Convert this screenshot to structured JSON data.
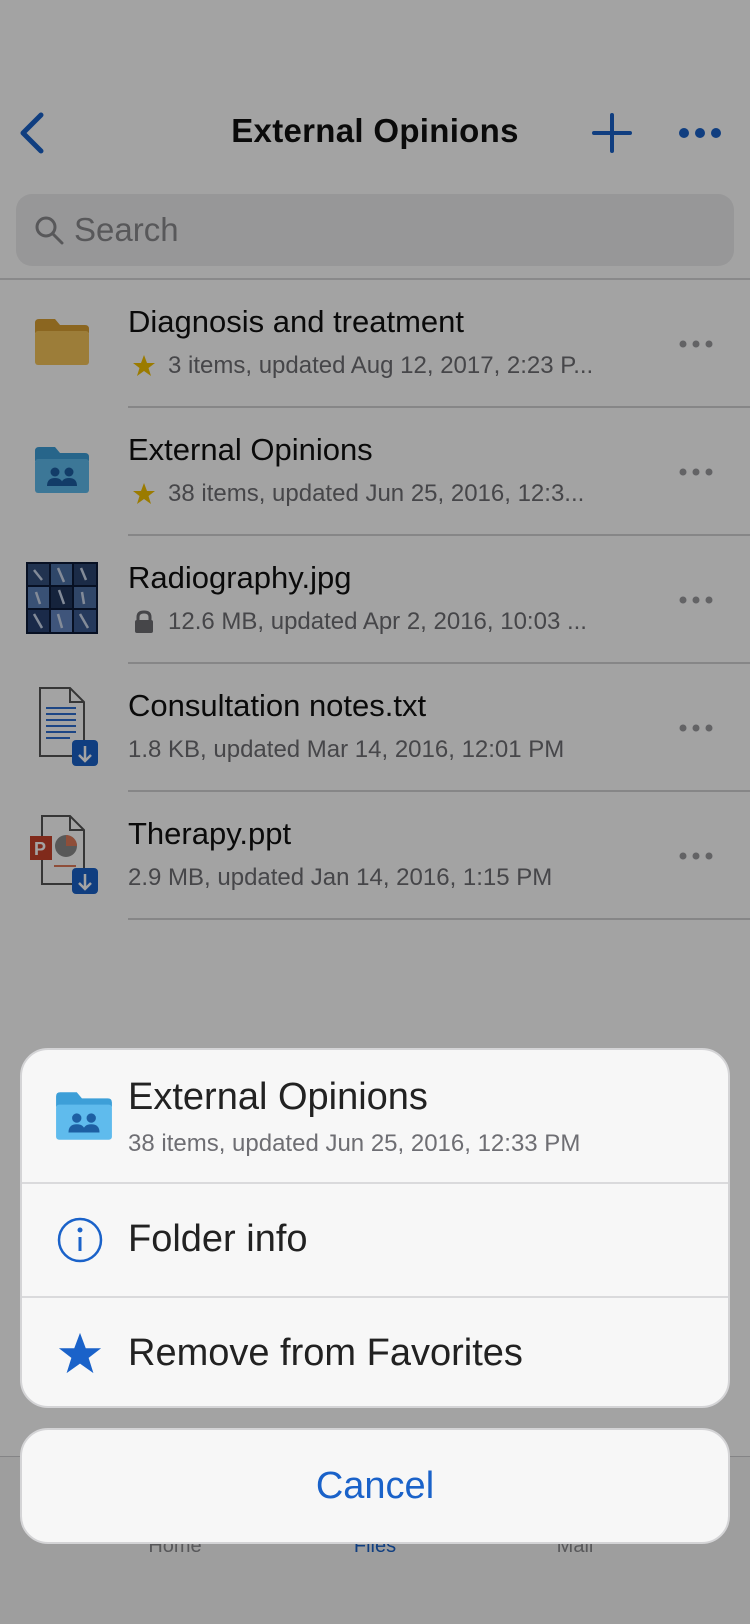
{
  "nav": {
    "title": "External Opinions",
    "back_icon": "chevron-left-icon",
    "add_icon": "plus-icon",
    "more_icon": "ellipsis-icon"
  },
  "search": {
    "placeholder": "Search"
  },
  "files": [
    {
      "name": "Diagnosis and treatment",
      "meta": "3 items, updated Aug 12, 2017, 2:23 P...",
      "badge": "star",
      "type": "folder"
    },
    {
      "name": "External Opinions",
      "meta": "38 items, updated Jun 25, 2016, 12:3...",
      "badge": "star",
      "type": "shared-folder"
    },
    {
      "name": "Radiography.jpg",
      "meta": "12.6 MB, updated Apr 2, 2016, 10:03 ...",
      "badge": "lock",
      "type": "image"
    },
    {
      "name": "Consultation notes.txt",
      "meta": "1.8 KB, updated Mar 14, 2016, 12:01 PM",
      "badge": "",
      "type": "text"
    },
    {
      "name": "Therapy.ppt",
      "meta": "2.9 MB, updated Jan 14, 2016, 1:15 PM",
      "badge": "",
      "type": "ppt"
    }
  ],
  "tabbar": {
    "home": "Home",
    "files": "Files",
    "mail": "Mail"
  },
  "sheet": {
    "title": "External Opinions",
    "subtitle": "38 items, updated Jun 25, 2016, 12:33 PM",
    "folder_info": "Folder info",
    "remove_favorites": "Remove from Favorites",
    "cancel": "Cancel"
  },
  "colors": {
    "accent": "#1a62c9",
    "star": "#f2c100",
    "folder_yellow": "#f5c45a",
    "folder_blue": "#5fbbed"
  }
}
